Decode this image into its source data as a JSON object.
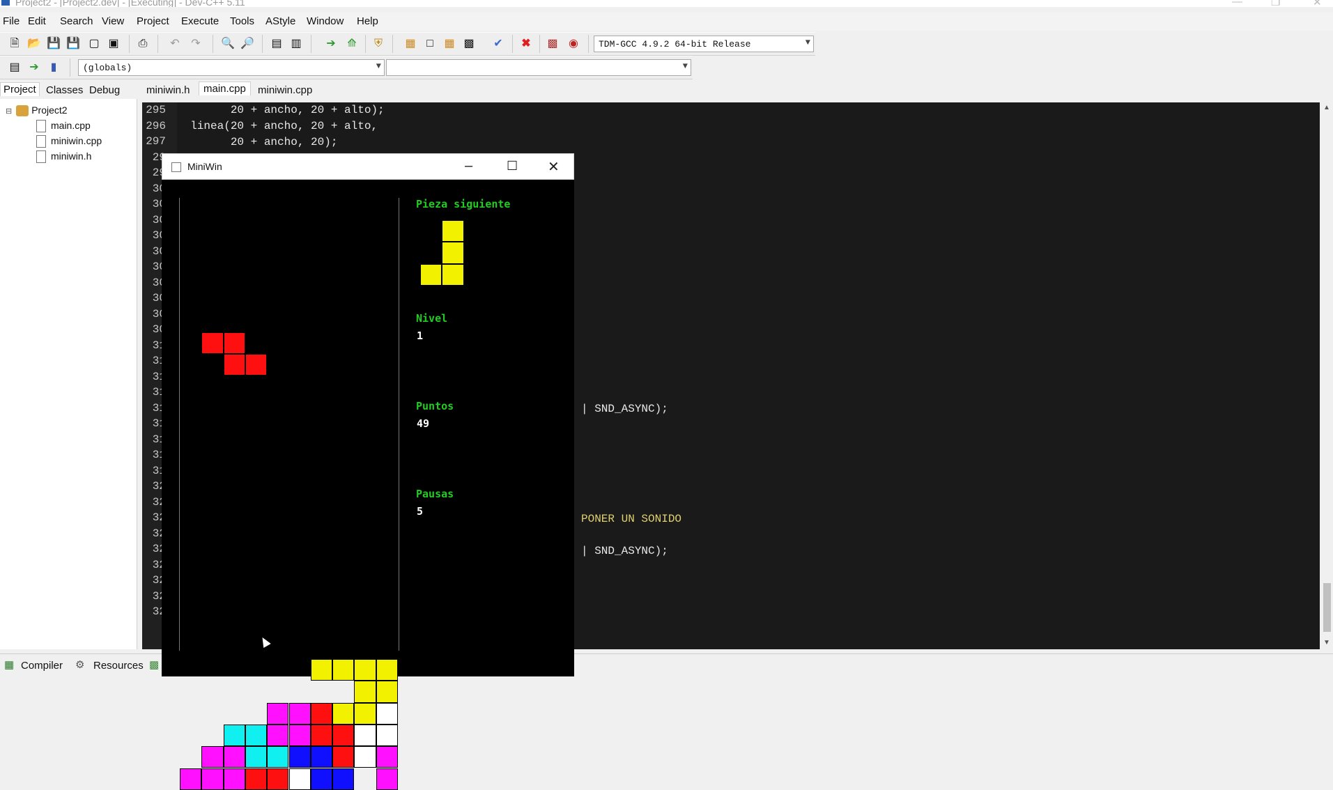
{
  "window": {
    "title": "Project2 - [Project2.dev] - [Executing] - Dev-C++ 5.11"
  },
  "menu": [
    "File",
    "Edit",
    "Search",
    "View",
    "Project",
    "Execute",
    "Tools",
    "AStyle",
    "Window",
    "Help"
  ],
  "toolbar": {
    "compiler_select": "TDM-GCC 4.9.2 64-bit Release",
    "globals_select": "(globals)",
    "members_select": ""
  },
  "left_tabs": [
    "Project",
    "Classes",
    "Debug"
  ],
  "project_tree": {
    "root": "Project2",
    "files": [
      "main.cpp",
      "miniwin.cpp",
      "miniwin.h"
    ]
  },
  "editor_tabs": [
    "miniwin.h",
    "main.cpp",
    "miniwin.cpp"
  ],
  "editor": {
    "line_numbers": [
      "295",
      "296",
      "297",
      "29",
      "29",
      "30",
      "30",
      "30",
      "30",
      "30",
      "30",
      "30",
      "30",
      "30",
      "30",
      "31",
      "31",
      "31",
      "31",
      "31",
      "31",
      "31",
      "31",
      "31",
      "32",
      "32",
      "32",
      "32",
      "32",
      "32",
      "32",
      "32",
      "32"
    ],
    "code": [
      "        20 + ancho, 20 + alto);",
      "  linea(20 + ancho, 20 + alto,",
      "        20 + ancho, 20);"
    ],
    "fragments": [
      "| SND_ASYNC);",
      "PONER UN SONIDO",
      "| SND_ASYNC);"
    ]
  },
  "bottom_tabs": [
    "Compiler",
    "Resources"
  ],
  "game": {
    "window_title": "MiniWin",
    "labels": {
      "next": "Pieza siguiente",
      "level": "Nivel",
      "points": "Puntos",
      "pauses": "Pausas"
    },
    "values": {
      "level": "1",
      "points": "49",
      "pauses": "5"
    },
    "colors": {
      "R": "#ff1010",
      "Y": "#f2f200",
      "M": "#ff10ff",
      "C": "#10f0f0",
      "B": "#1010ff",
      "W": "#ffffff"
    },
    "board": [
      "..........",
      "..........",
      "..........",
      "..........",
      "..........",
      ".RR.......",
      "..RR......",
      "..........",
      "..........",
      "..........",
      "..........",
      "..........",
      "..........",
      "..........",
      "..........",
      "..........",
      "..........",
      "..........",
      "..........",
      "..........",
      "......YYYY",
      "........YY",
      "....MMRYYW",
      "..CCMMRRWW",
      ".MMCCBBRWM",
      "MMMRRWBB.M"
    ],
    "next_piece": [
      ".Y",
      ".Y",
      "YY"
    ]
  }
}
